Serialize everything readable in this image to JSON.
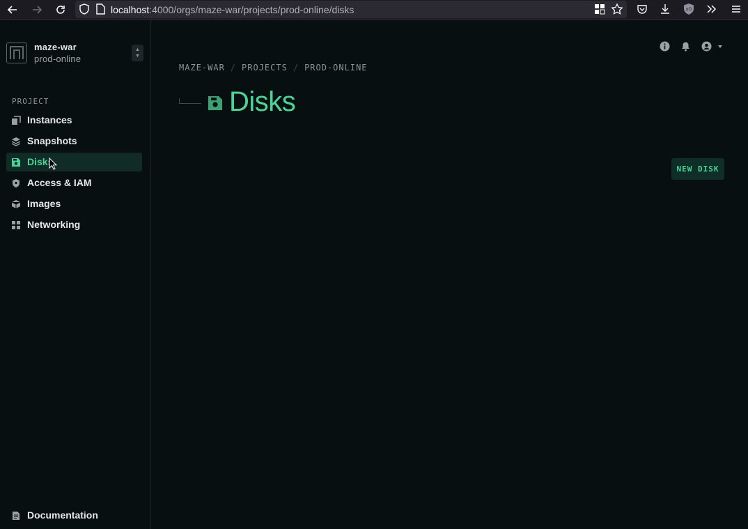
{
  "browser": {
    "url_host": "localhost",
    "url_path": ":4000/orgs/maze-war/projects/prod-online/disks"
  },
  "sidebar": {
    "org_name": "maze-war",
    "project_name": "prod-online",
    "section_label": "PROJECT",
    "items": [
      {
        "label": "Instances",
        "icon": "instances-icon",
        "active": false
      },
      {
        "label": "Snapshots",
        "icon": "snapshots-icon",
        "active": false
      },
      {
        "label": "Disks",
        "icon": "disk-icon",
        "active": true
      },
      {
        "label": "Access & IAM",
        "icon": "shield-icon",
        "active": false
      },
      {
        "label": "Images",
        "icon": "cube-icon",
        "active": false
      },
      {
        "label": "Networking",
        "icon": "grid-icon",
        "active": false
      }
    ],
    "footer_link": "Documentation"
  },
  "header": {
    "breadcrumb": [
      "MAZE-WAR",
      "PROJECTS",
      "PROD-ONLINE"
    ],
    "title": "Disks"
  },
  "actions": {
    "new_disk_label": "NEW DISK"
  },
  "colors": {
    "accent": "#48d597",
    "background": "#080f11",
    "active_bg": "#112b26"
  }
}
